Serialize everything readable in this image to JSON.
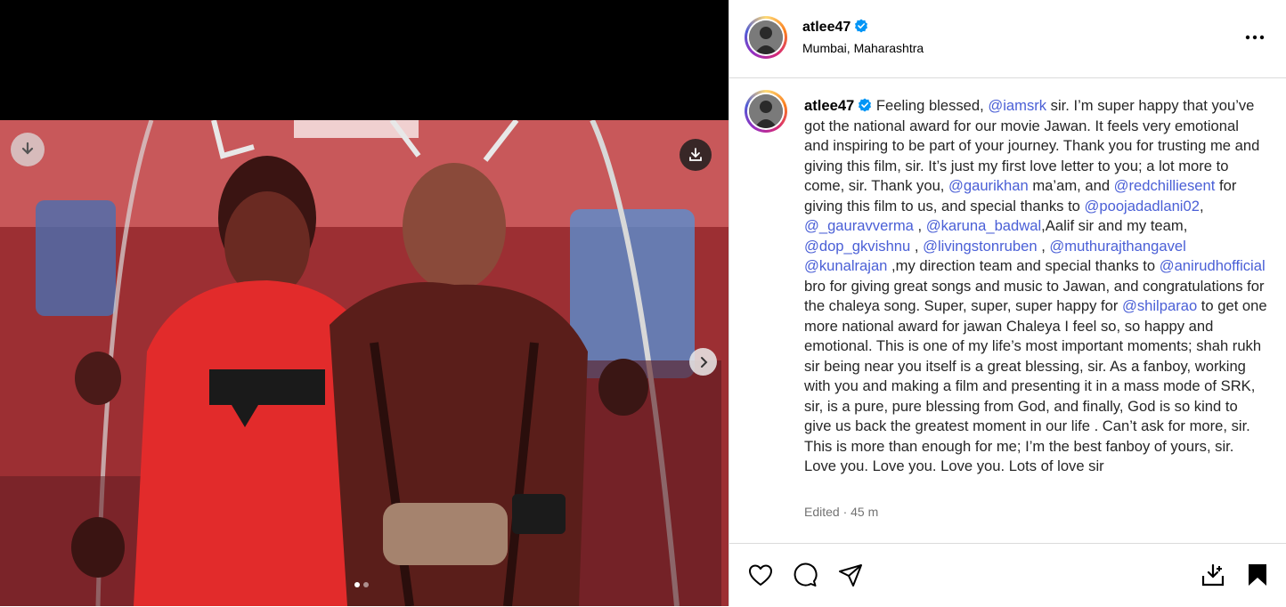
{
  "post": {
    "username": "atlee47",
    "verified": true,
    "location": "Mumbai, Maharashtra",
    "more_options_icon": "more-horizontal-icon"
  },
  "media": {
    "download_icon": "download-icon",
    "next_icon": "chevron-right-icon",
    "carousel_total": 2,
    "carousel_active": 1
  },
  "caption": {
    "username": "atlee47",
    "segments": [
      {
        "t": "Feeling blessed, "
      },
      {
        "m": "@iamsrk"
      },
      {
        "t": " sir. I’m super happy that you’ve got the national award for our movie Jawan. It feels very emotional and inspiring to be part of your journey. Thank you for trusting me and giving this film, sir. It’s just my first love letter to you; a lot more to come, sir. Thank you, "
      },
      {
        "m": "@gaurikhan"
      },
      {
        "t": " ma’am, and "
      },
      {
        "m": "@redchilliesent"
      },
      {
        "t": " for giving this film to us, and special thanks to "
      },
      {
        "m": "@poojadadlani02"
      },
      {
        "t": ", "
      },
      {
        "m": "@_gauravverma"
      },
      {
        "t": " , "
      },
      {
        "m": "@karuna_badwal"
      },
      {
        "t": ",Aalif sir and my team, "
      },
      {
        "m": "@dop_gkvishnu"
      },
      {
        "t": " , "
      },
      {
        "m": "@livingstonruben"
      },
      {
        "t": " , "
      },
      {
        "m": "@muthurajthangavel"
      },
      {
        "t": " "
      },
      {
        "m": "@kunalrajan"
      },
      {
        "t": " ,my direction team and special thanks to "
      },
      {
        "m": "@anirudhofficial"
      },
      {
        "t": " bro for giving great songs and music to Jawan, and congratulations for the chaleya song. Super, super, super happy for "
      },
      {
        "m": "@shilparao"
      },
      {
        "t": " to get one more national award for jawan Chaleya I feel so, so happy and emotional. This is one of my life’s most important moments; shah rukh sir being near you itself is a great blessing, sir. As a fanboy, working with you and making a film and presenting it in a mass mode of SRK, sir, is a pure, pure blessing from God, and finally, God is so kind to give us back the greatest moment in our life . Can’t ask for more, sir. This is more than enough for me; I’m the best fanboy of yours, sir. Love you. Love you. Love you. Lots of love sir"
      }
    ],
    "edited": "Edited · 45 m"
  },
  "actions": {
    "like_icon": "heart-icon",
    "comment_icon": "comment-icon",
    "share_icon": "share-icon",
    "save_download_icon": "download-tray-icon",
    "bookmark_icon": "bookmark-icon"
  },
  "colors": {
    "mention": "#4a5fd6",
    "border": "#dbdbdb",
    "verified": "#0095f6",
    "muted": "#737373"
  }
}
